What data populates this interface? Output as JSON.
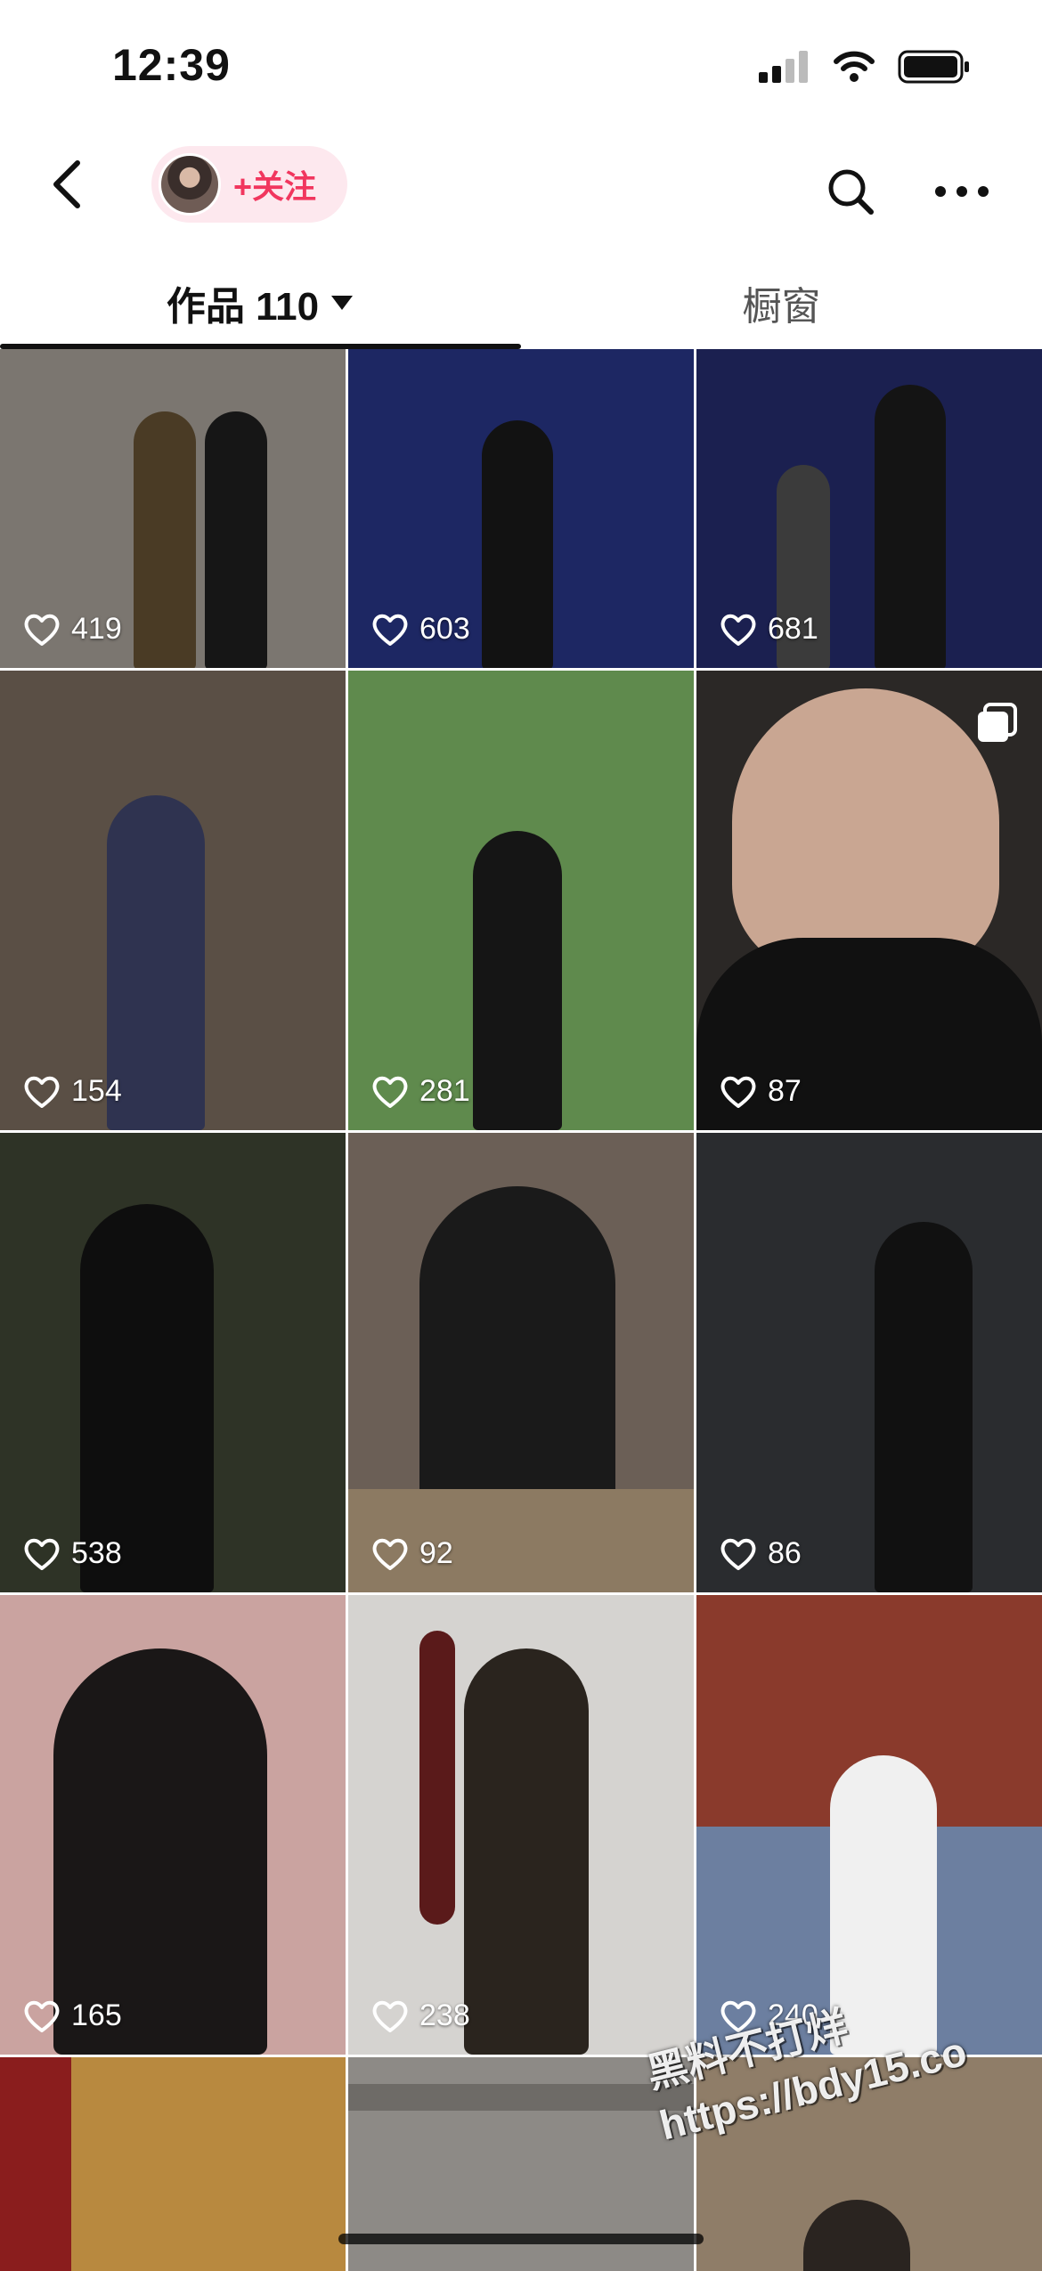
{
  "status": {
    "time": "12:39"
  },
  "nav": {
    "follow_label": "+关注"
  },
  "tabs": {
    "works_label": "作品 110",
    "showcase_label": "橱窗"
  },
  "posts": [
    {
      "likes": "419",
      "bg": "#7b7670"
    },
    {
      "likes": "603",
      "bg": "#1d2763"
    },
    {
      "likes": "681",
      "bg": "#1b2050"
    },
    {
      "likes": "154",
      "bg": "#5a4f45"
    },
    {
      "likes": "281",
      "bg": "#5f8a4d"
    },
    {
      "likes": "87",
      "bg": "#2b2826"
    },
    {
      "likes": "538",
      "bg": "#2e3326"
    },
    {
      "likes": "92",
      "bg": "#6b5f56"
    },
    {
      "likes": "86",
      "bg": "#2a2c2f"
    },
    {
      "likes": "165",
      "bg": "#caa3a0"
    },
    {
      "likes": "238",
      "bg": "#d5d3d0"
    },
    {
      "likes": "240",
      "bg": "#6c7fa0"
    },
    {
      "likes": "",
      "bg": "#b8893f"
    },
    {
      "likes": "",
      "bg": "#8d8a86"
    },
    {
      "likes": "",
      "bg": "#8f7d68"
    }
  ],
  "watermark": {
    "line1": "黑料不打烊",
    "line2": "https://bdy15.co"
  },
  "colors": {
    "accent": "#f1365e",
    "pill_bg": "#fde8ee"
  }
}
